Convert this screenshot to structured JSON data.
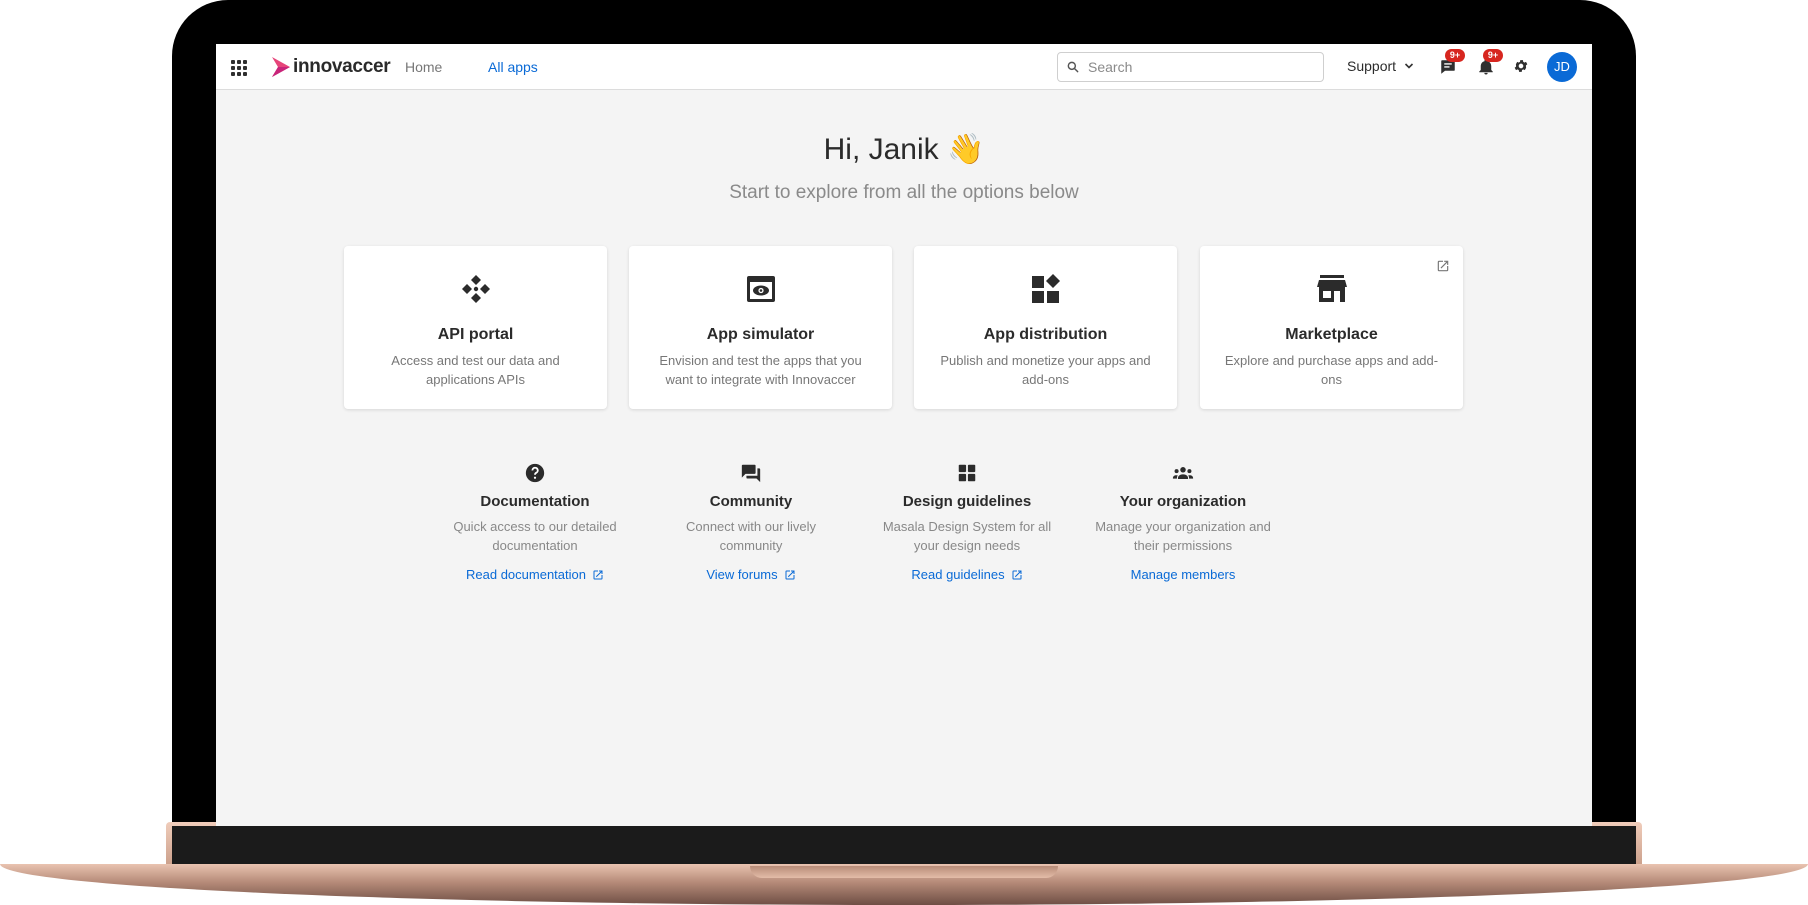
{
  "nav": {
    "brand": "innovaccer",
    "home": "Home",
    "all_apps": "All apps",
    "search_placeholder": "Search",
    "support": "Support",
    "messages_badge": "9+",
    "notifications_badge": "9+",
    "avatar_initials": "JD"
  },
  "hero": {
    "greeting": "Hi, Janik 👋",
    "subtitle": "Start to explore from all the options below"
  },
  "cards": [
    {
      "icon": "api-icon",
      "title": "API portal",
      "desc": "Access and test our data and applications APIs"
    },
    {
      "icon": "eye-window-icon",
      "title": "App simulator",
      "desc": "Envision and test the apps that you want to integrate with Innovaccer"
    },
    {
      "icon": "widgets-icon",
      "title": "App distribution",
      "desc": "Publish and monetize your apps and add-ons"
    },
    {
      "icon": "store-icon",
      "title": "Marketplace",
      "desc": "Explore and purchase apps and add-ons"
    }
  ],
  "resources": [
    {
      "icon": "help-icon",
      "title": "Documentation",
      "desc": "Quick access to our detailed documentation",
      "link": "Read documentation"
    },
    {
      "icon": "forum-icon",
      "title": "Community",
      "desc": "Connect with our lively community",
      "link": "View forums"
    },
    {
      "icon": "dashboard-icon",
      "title": "Design guidelines",
      "desc": "Masala Design System for all your design needs",
      "link": "Read guidelines"
    },
    {
      "icon": "groups-icon",
      "title": "Your organization",
      "desc": "Manage your organization and their permissions",
      "link": "Manage members"
    }
  ],
  "colors": {
    "accent": "#0a6ad6",
    "badge": "#d7261f",
    "background": "#f4f4f4"
  }
}
